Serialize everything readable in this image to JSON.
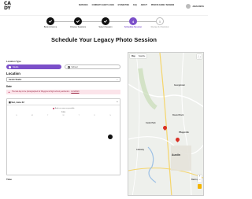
{
  "header": {
    "logo_top": "CA",
    "logo_bottom": "DY",
    "nav": [
      "SERVICES",
      "CURRENT CLIENT LOGIN",
      "ETHNICITIES",
      "FAQ",
      "ABOUT",
      "PRIVATE FAMILY SESSION"
    ],
    "user_name": "JOHN SMITH"
  },
  "steps": [
    {
      "label": "Book At Home",
      "state": "done"
    },
    {
      "label": "Choose Sessions",
      "state": "done"
    },
    {
      "label": "Select Session",
      "state": "done"
    },
    {
      "label": "Schedule Session",
      "state": "current",
      "number": "4"
    },
    {
      "label": "Review & Checkout",
      "state": "future",
      "number": "5"
    }
  ],
  "page_title": "Schedule Your Legacy Photo Session",
  "form": {
    "location_type_label": "Location Type",
    "location_type_options": [
      "Studio",
      "School"
    ],
    "location_heading": "Location",
    "location_value": "Austin Studio",
    "date_label": "Date",
    "alert_text": "The last day to be photographed for Playground high school yearbook is",
    "alert_link": "12/1/2023",
    "calendar_selected": "Sat, June 22",
    "calendar_note": "Book as soon as possible",
    "month": "June",
    "weekdays": [
      "S",
      "M",
      "T",
      "W",
      "T",
      "F",
      "S"
    ],
    "time_label": "Time"
  },
  "map": {
    "tab_map": "Map",
    "tab_sat": "Satellite",
    "cities": [
      "Georgetown",
      "Round Rock",
      "Cedar Park",
      "Pflugerville",
      "Austin",
      "Lakeway",
      "Bastrop"
    ]
  },
  "colors": {
    "accent": "#7b4fc9",
    "alert_bg": "#fbe4ea",
    "pin": "#d93025"
  }
}
